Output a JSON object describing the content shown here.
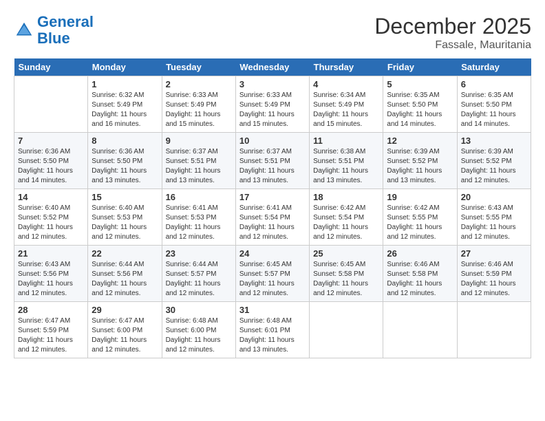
{
  "header": {
    "logo_line1": "General",
    "logo_line2": "Blue",
    "month": "December 2025",
    "location": "Fassale, Mauritania"
  },
  "days_of_week": [
    "Sunday",
    "Monday",
    "Tuesday",
    "Wednesday",
    "Thursday",
    "Friday",
    "Saturday"
  ],
  "weeks": [
    [
      {
        "day": "",
        "info": ""
      },
      {
        "day": "1",
        "info": "Sunrise: 6:32 AM\nSunset: 5:49 PM\nDaylight: 11 hours\nand 16 minutes."
      },
      {
        "day": "2",
        "info": "Sunrise: 6:33 AM\nSunset: 5:49 PM\nDaylight: 11 hours\nand 15 minutes."
      },
      {
        "day": "3",
        "info": "Sunrise: 6:33 AM\nSunset: 5:49 PM\nDaylight: 11 hours\nand 15 minutes."
      },
      {
        "day": "4",
        "info": "Sunrise: 6:34 AM\nSunset: 5:49 PM\nDaylight: 11 hours\nand 15 minutes."
      },
      {
        "day": "5",
        "info": "Sunrise: 6:35 AM\nSunset: 5:50 PM\nDaylight: 11 hours\nand 14 minutes."
      },
      {
        "day": "6",
        "info": "Sunrise: 6:35 AM\nSunset: 5:50 PM\nDaylight: 11 hours\nand 14 minutes."
      }
    ],
    [
      {
        "day": "7",
        "info": "Sunrise: 6:36 AM\nSunset: 5:50 PM\nDaylight: 11 hours\nand 14 minutes."
      },
      {
        "day": "8",
        "info": "Sunrise: 6:36 AM\nSunset: 5:50 PM\nDaylight: 11 hours\nand 13 minutes."
      },
      {
        "day": "9",
        "info": "Sunrise: 6:37 AM\nSunset: 5:51 PM\nDaylight: 11 hours\nand 13 minutes."
      },
      {
        "day": "10",
        "info": "Sunrise: 6:37 AM\nSunset: 5:51 PM\nDaylight: 11 hours\nand 13 minutes."
      },
      {
        "day": "11",
        "info": "Sunrise: 6:38 AM\nSunset: 5:51 PM\nDaylight: 11 hours\nand 13 minutes."
      },
      {
        "day": "12",
        "info": "Sunrise: 6:39 AM\nSunset: 5:52 PM\nDaylight: 11 hours\nand 13 minutes."
      },
      {
        "day": "13",
        "info": "Sunrise: 6:39 AM\nSunset: 5:52 PM\nDaylight: 11 hours\nand 12 minutes."
      }
    ],
    [
      {
        "day": "14",
        "info": "Sunrise: 6:40 AM\nSunset: 5:52 PM\nDaylight: 11 hours\nand 12 minutes."
      },
      {
        "day": "15",
        "info": "Sunrise: 6:40 AM\nSunset: 5:53 PM\nDaylight: 11 hours\nand 12 minutes."
      },
      {
        "day": "16",
        "info": "Sunrise: 6:41 AM\nSunset: 5:53 PM\nDaylight: 11 hours\nand 12 minutes."
      },
      {
        "day": "17",
        "info": "Sunrise: 6:41 AM\nSunset: 5:54 PM\nDaylight: 11 hours\nand 12 minutes."
      },
      {
        "day": "18",
        "info": "Sunrise: 6:42 AM\nSunset: 5:54 PM\nDaylight: 11 hours\nand 12 minutes."
      },
      {
        "day": "19",
        "info": "Sunrise: 6:42 AM\nSunset: 5:55 PM\nDaylight: 11 hours\nand 12 minutes."
      },
      {
        "day": "20",
        "info": "Sunrise: 6:43 AM\nSunset: 5:55 PM\nDaylight: 11 hours\nand 12 minutes."
      }
    ],
    [
      {
        "day": "21",
        "info": "Sunrise: 6:43 AM\nSunset: 5:56 PM\nDaylight: 11 hours\nand 12 minutes."
      },
      {
        "day": "22",
        "info": "Sunrise: 6:44 AM\nSunset: 5:56 PM\nDaylight: 11 hours\nand 12 minutes."
      },
      {
        "day": "23",
        "info": "Sunrise: 6:44 AM\nSunset: 5:57 PM\nDaylight: 11 hours\nand 12 minutes."
      },
      {
        "day": "24",
        "info": "Sunrise: 6:45 AM\nSunset: 5:57 PM\nDaylight: 11 hours\nand 12 minutes."
      },
      {
        "day": "25",
        "info": "Sunrise: 6:45 AM\nSunset: 5:58 PM\nDaylight: 11 hours\nand 12 minutes."
      },
      {
        "day": "26",
        "info": "Sunrise: 6:46 AM\nSunset: 5:58 PM\nDaylight: 11 hours\nand 12 minutes."
      },
      {
        "day": "27",
        "info": "Sunrise: 6:46 AM\nSunset: 5:59 PM\nDaylight: 11 hours\nand 12 minutes."
      }
    ],
    [
      {
        "day": "28",
        "info": "Sunrise: 6:47 AM\nSunset: 5:59 PM\nDaylight: 11 hours\nand 12 minutes."
      },
      {
        "day": "29",
        "info": "Sunrise: 6:47 AM\nSunset: 6:00 PM\nDaylight: 11 hours\nand 12 minutes."
      },
      {
        "day": "30",
        "info": "Sunrise: 6:48 AM\nSunset: 6:00 PM\nDaylight: 11 hours\nand 12 minutes."
      },
      {
        "day": "31",
        "info": "Sunrise: 6:48 AM\nSunset: 6:01 PM\nDaylight: 11 hours\nand 13 minutes."
      },
      {
        "day": "",
        "info": ""
      },
      {
        "day": "",
        "info": ""
      },
      {
        "day": "",
        "info": ""
      }
    ]
  ]
}
